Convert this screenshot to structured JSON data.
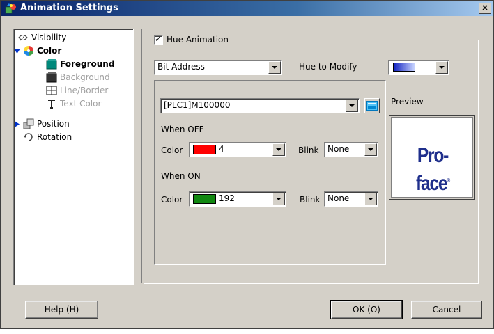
{
  "window": {
    "title": "Animation Settings",
    "close_glyph": "×"
  },
  "tree": {
    "items": [
      {
        "label": "Visibility",
        "icon": "visibility-icon"
      },
      {
        "label": "Color",
        "icon": "color-wheel-icon"
      },
      {
        "label": "Foreground",
        "icon": "foreground-icon"
      },
      {
        "label": "Background",
        "icon": "background-icon"
      },
      {
        "label": "Line/Border",
        "icon": "line-border-icon"
      },
      {
        "label": "Text Color",
        "icon": "text-color-icon"
      },
      {
        "label": "Position",
        "icon": "position-icon"
      },
      {
        "label": "Rotation",
        "icon": "rotation-icon"
      }
    ]
  },
  "hue": {
    "checkbox_label": "Hue Animation",
    "checked": true,
    "check_glyph": "✓",
    "mode_value": "Bit Address",
    "modify_label": "Hue to Modify",
    "modify_color": "#2233cc"
  },
  "address": {
    "value": "[PLC1]M100000"
  },
  "off": {
    "heading": "When OFF",
    "color_label": "Color",
    "color_value": "4",
    "color_hex": "#ff0000",
    "blink_label": "Blink",
    "blink_value": "None"
  },
  "on": {
    "heading": "When ON",
    "color_label": "Color",
    "color_value": "192",
    "color_hex": "#118811",
    "blink_label": "Blink",
    "blink_value": "None"
  },
  "preview": {
    "label": "Preview",
    "logo_text": "Pro-face",
    "logo_mark": "®"
  },
  "buttons": {
    "help": "Help (H)",
    "ok": "OK (O)",
    "cancel": "Cancel"
  }
}
